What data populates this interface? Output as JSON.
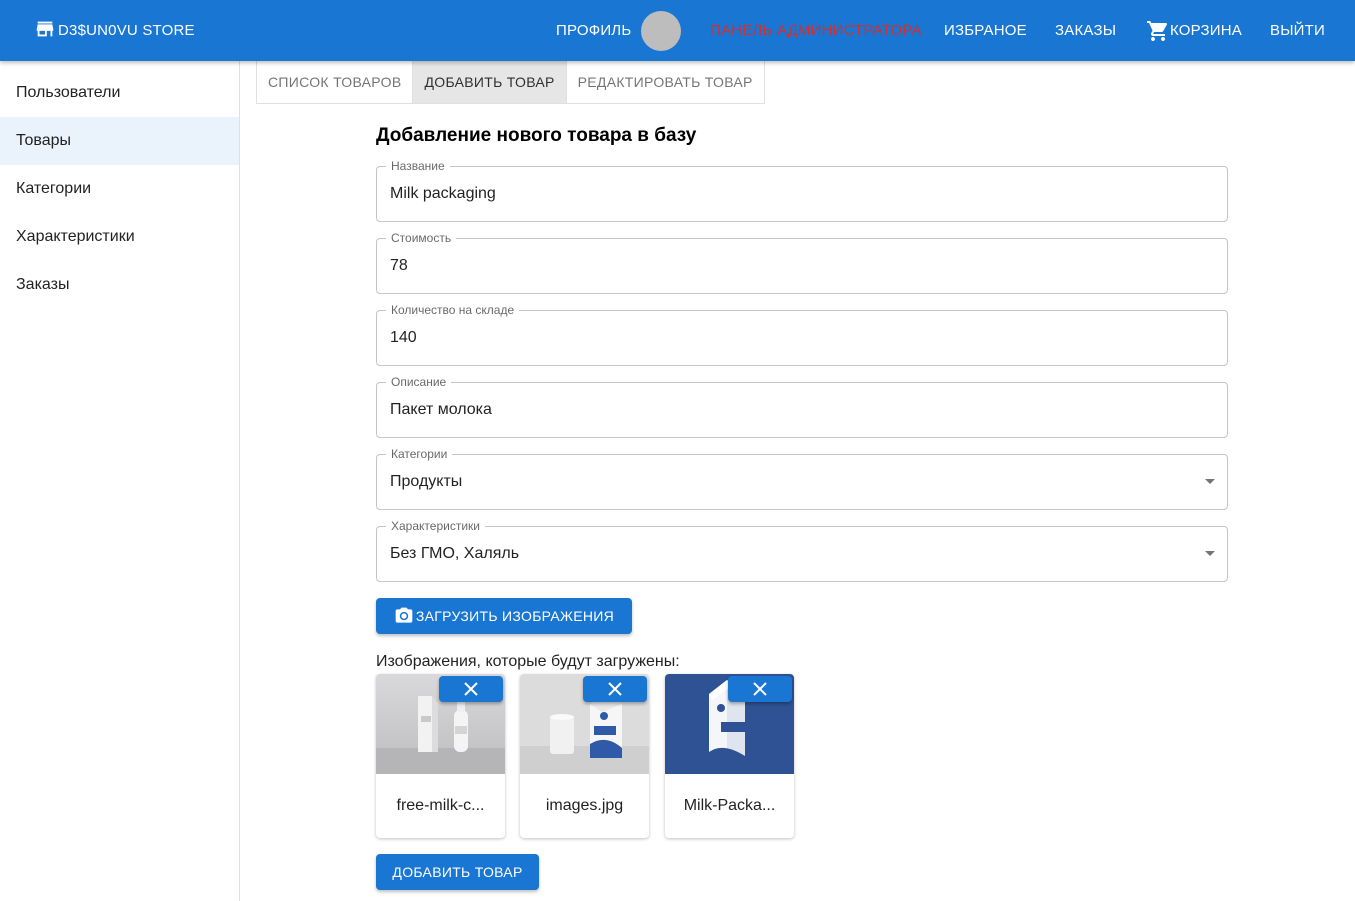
{
  "header": {
    "brand": "D3$UN0VU STORE",
    "profile": "ПРОФИЛЬ",
    "admin_panel": "ПАНЕЛЬ АДМИНИСТРАТОРА",
    "favorites": "ИЗБРАНОЕ",
    "orders": "ЗАКАЗЫ",
    "cart": "КОРЗИНА",
    "logout": "ВЫЙТИ"
  },
  "sidebar": {
    "items": [
      {
        "label": "Пользователи"
      },
      {
        "label": "Товары"
      },
      {
        "label": "Категории"
      },
      {
        "label": "Характеристики"
      },
      {
        "label": "Заказы"
      }
    ]
  },
  "tabs": [
    {
      "label": "СПИСОК ТОВАРОВ"
    },
    {
      "label": "ДОБАВИТЬ ТОВАР"
    },
    {
      "label": "РЕДАКТИРОВАТЬ ТОВАР"
    }
  ],
  "form": {
    "title": "Добавление нового товара в базу",
    "name": {
      "label": "Название",
      "value": "Milk packaging"
    },
    "price": {
      "label": "Стоимость",
      "value": "78"
    },
    "stock": {
      "label": "Количество на складе",
      "value": "140"
    },
    "description": {
      "label": "Описание",
      "value": "Пакет молока"
    },
    "category": {
      "label": "Категории",
      "value": "Продукты"
    },
    "characteristics": {
      "label": "Характеристики",
      "value": "Без ГМО, Халяль"
    },
    "upload_button": "ЗАГРУЗИТЬ ИЗОБРАЖЕНИЯ",
    "upload_caption": "Изображения, которые будут загружены:",
    "images": [
      {
        "filename": "free-milk-c..."
      },
      {
        "filename": "images.jpg"
      },
      {
        "filename": "Milk-Packa..."
      }
    ],
    "submit_button": "ДОБАВИТЬ ТОВАР"
  },
  "colors": {
    "primary": "#1976d2",
    "admin_link": "#d32f2f",
    "active_sidebar": "#eaf2fb"
  }
}
